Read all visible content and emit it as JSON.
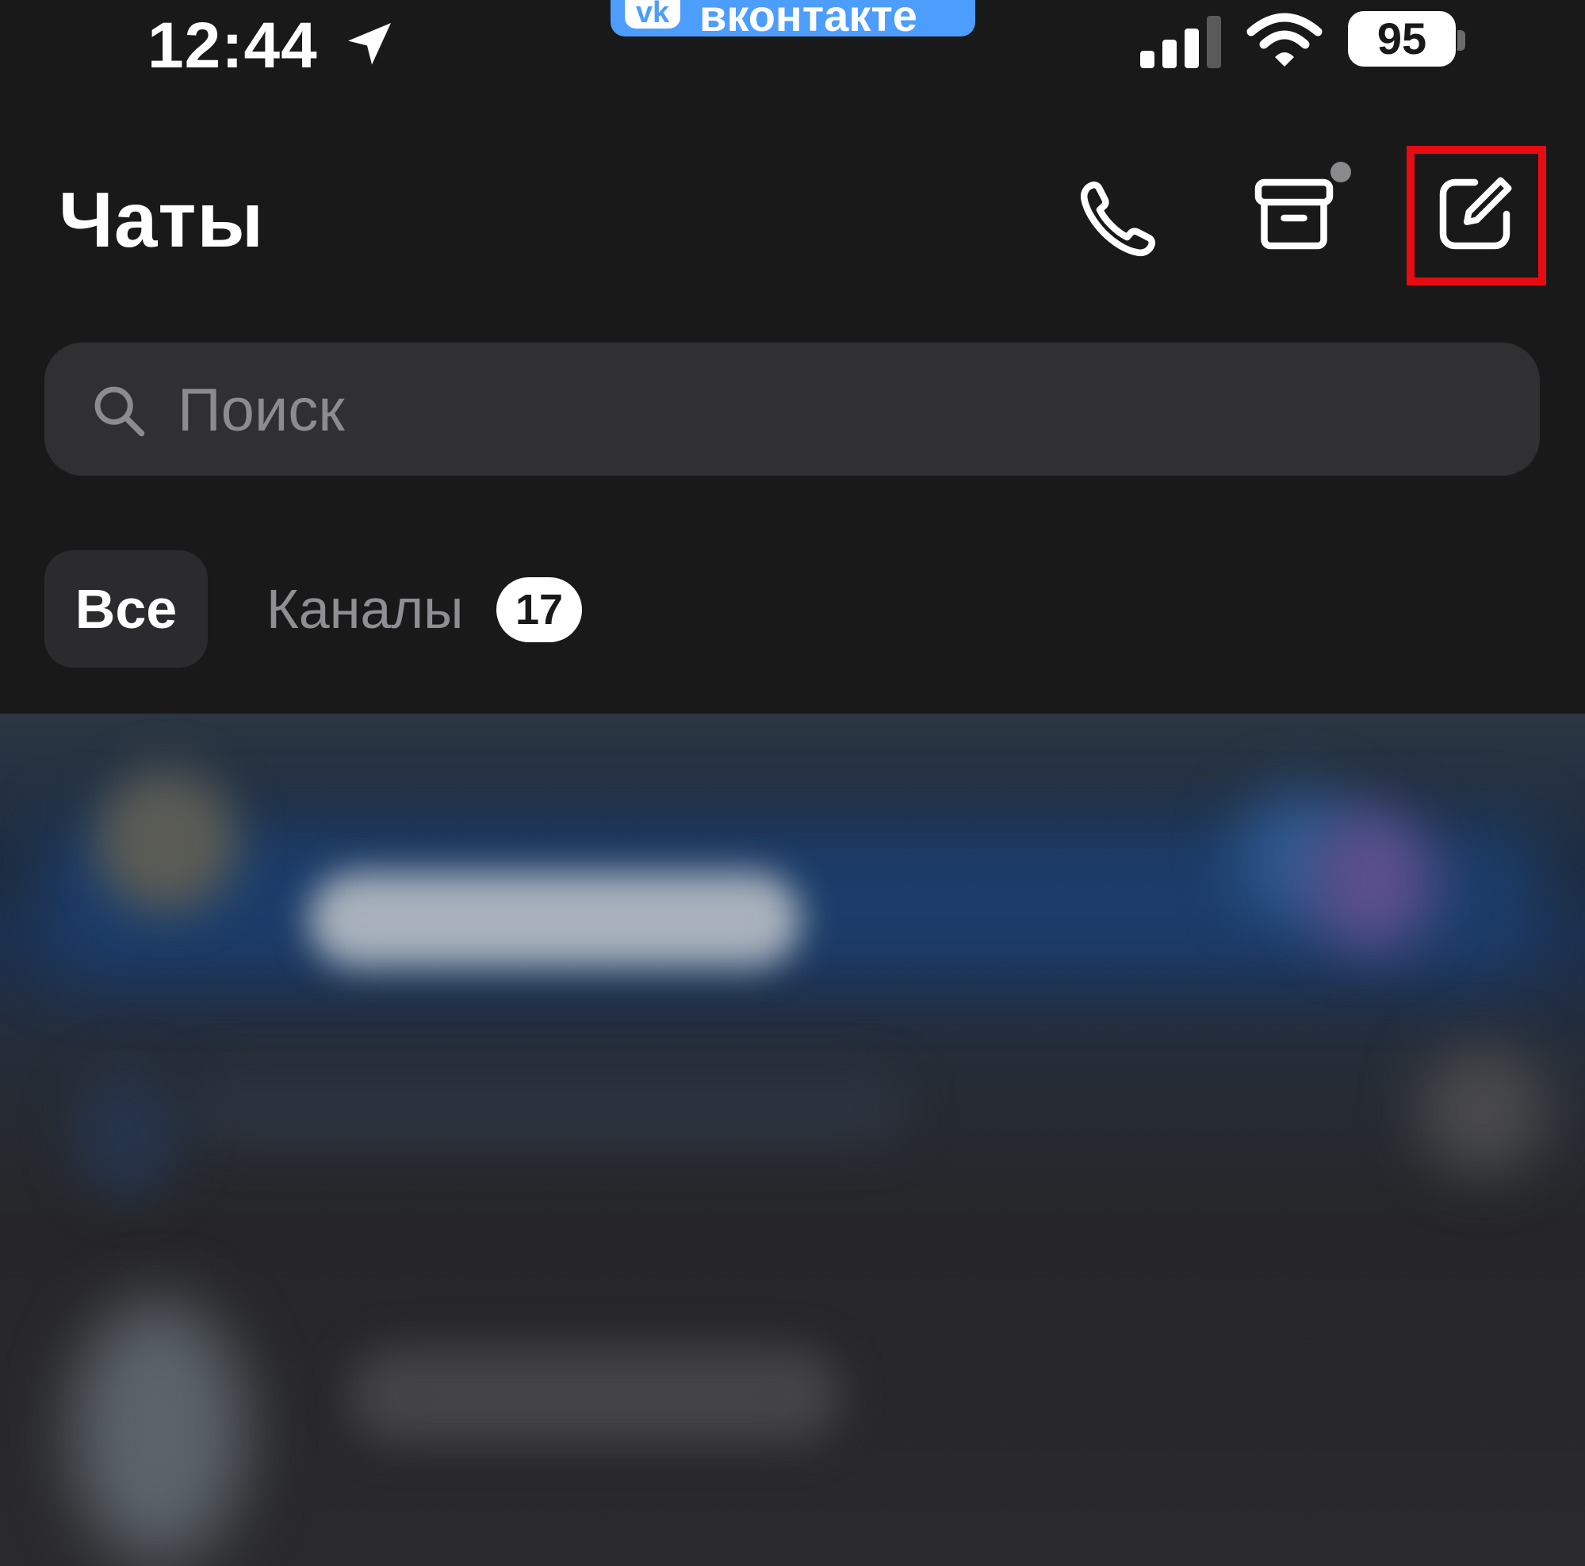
{
  "status_bar": {
    "time": "12:44",
    "app_pill_name": "вконтакте",
    "app_pill_logo": "vk",
    "battery": "95",
    "icons": [
      "location-arrow-icon",
      "cellular-signal-icon",
      "wifi-icon",
      "battery-icon"
    ]
  },
  "header": {
    "title": "Чаты",
    "actions": [
      "phone-icon",
      "archive-icon",
      "compose-icon"
    ]
  },
  "search": {
    "placeholder": "Поиск"
  },
  "tabs": [
    {
      "label": "Все",
      "selected": true
    },
    {
      "label": "Каналы",
      "badge": "17",
      "selected": false
    }
  ],
  "colors": {
    "background": "#19191a",
    "accent": "#4c9dfc",
    "highlight": "#e60c12",
    "search_bg": "#303033",
    "tab_inactive": "#8e8e93"
  }
}
